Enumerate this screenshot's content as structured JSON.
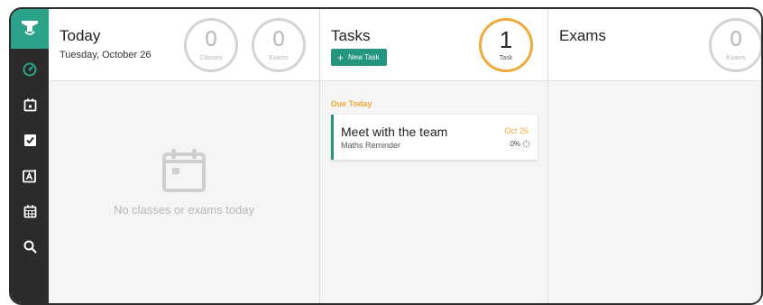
{
  "sidebar": {
    "items": [
      {
        "icon": "dashboard-icon"
      },
      {
        "icon": "calendar-day-icon"
      },
      {
        "icon": "checkbox-icon"
      },
      {
        "icon": "exam-icon"
      },
      {
        "icon": "calendar-grid-icon"
      },
      {
        "icon": "search-icon"
      }
    ]
  },
  "today": {
    "title": "Today",
    "date": "Tuesday, October 26",
    "classes_count": "0",
    "classes_label": "Classes",
    "exams_count": "0",
    "exams_label": "Exams",
    "empty_text": "No classes or exams today"
  },
  "tasks": {
    "title": "Tasks",
    "new_task_label": "New Task",
    "count": "1",
    "count_label": "Task",
    "section_label": "Due Today",
    "items": [
      {
        "title": "Meet with the team",
        "subtitle": "Maths Reminder",
        "date": "Oct 26",
        "progress": "0%"
      }
    ]
  },
  "exams": {
    "title": "Exams",
    "count": "0",
    "count_label": "Exams"
  },
  "colors": {
    "accent": "#23967d",
    "logo_bg": "#2aa38a",
    "due": "#f0a93b",
    "sidebar_bg": "#2b2b2b"
  }
}
